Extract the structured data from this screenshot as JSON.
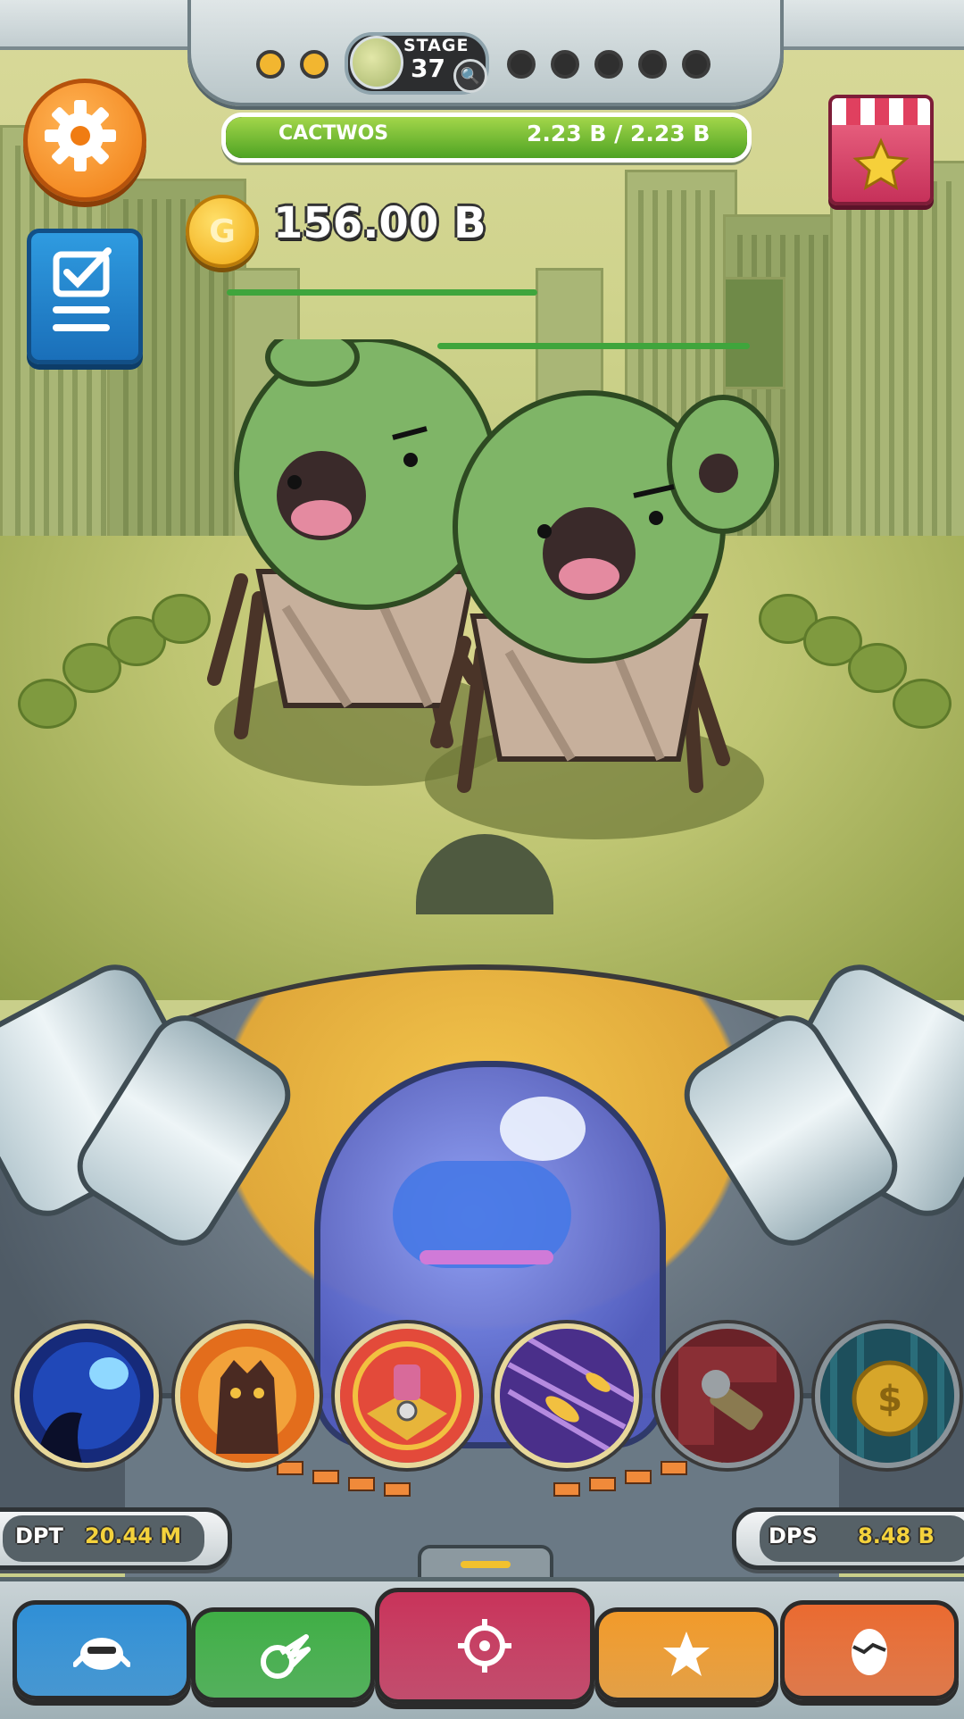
{
  "stage": {
    "label": "STAGE",
    "number": "37",
    "progress_dots": [
      "done",
      "done",
      "todo",
      "todo",
      "todo",
      "todo",
      "todo"
    ]
  },
  "enemy": {
    "name": "CACTWOS",
    "hp_text": "2.23 B / 2.23 B",
    "hp_fraction": 1.0
  },
  "gold": {
    "coin_letter": "G",
    "amount": "156.00 B"
  },
  "stats": {
    "dpt_label": "DPT",
    "dpt_value": "20.44 M",
    "dps_label": "DPS",
    "dps_value": "8.48 B"
  },
  "skills": [
    {
      "icon": "comet-strike-icon",
      "locked": false
    },
    {
      "icon": "demon-rage-icon",
      "locked": false
    },
    {
      "icon": "turret-icon",
      "locked": false
    },
    {
      "icon": "bullet-rain-icon",
      "locked": false
    },
    {
      "icon": "cannon-shell-icon",
      "locked": true
    },
    {
      "icon": "gold-coin-icon",
      "locked": true
    }
  ],
  "nav": [
    {
      "name": "pilot-tab",
      "icon": "pilot-icon",
      "color": "#2f8fd6"
    },
    {
      "name": "weapons-tab",
      "icon": "claw-icon",
      "color": "#3fae45"
    },
    {
      "name": "battle-tab",
      "icon": "crosshair-icon",
      "color": "#c8335a"
    },
    {
      "name": "favorites-tab",
      "icon": "star-icon",
      "color": "#f19a2a"
    },
    {
      "name": "egg-tab",
      "icon": "egg-icon",
      "color": "#ea6a30"
    }
  ],
  "colors": {
    "hp_green": "#4ea323",
    "gold": "#f0a812",
    "stat_value": "#f4d23c"
  }
}
